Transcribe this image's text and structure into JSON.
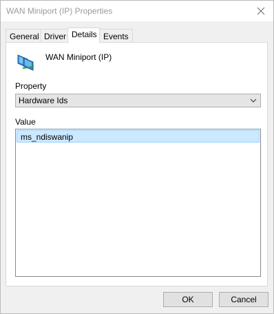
{
  "window": {
    "title": "WAN Miniport (IP) Properties"
  },
  "tabs": [
    {
      "label": "General",
      "active": false
    },
    {
      "label": "Driver",
      "active": false
    },
    {
      "label": "Details",
      "active": true
    },
    {
      "label": "Events",
      "active": false
    }
  ],
  "device": {
    "name": "WAN Miniport (IP)",
    "icon": "network-adapter-icon"
  },
  "property": {
    "label": "Property",
    "selected": "Hardware Ids"
  },
  "value": {
    "label": "Value",
    "items": [
      "ms_ndiswanip"
    ]
  },
  "buttons": {
    "ok": "OK",
    "cancel": "Cancel"
  },
  "colors": {
    "selection_bg": "#cce8ff",
    "selection_border": "#99d1ff",
    "title_text": "#9a9a9a"
  }
}
